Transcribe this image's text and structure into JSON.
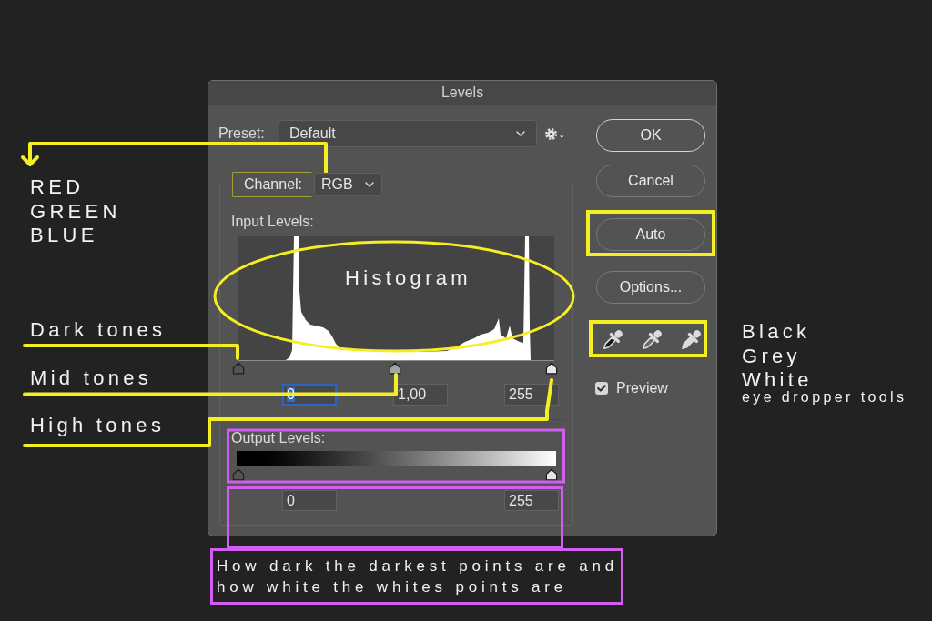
{
  "dialog": {
    "title": "Levels",
    "preset": {
      "label": "Preset:",
      "value": "Default"
    },
    "channel": {
      "label": "Channel:",
      "value": "RGB"
    },
    "input_levels": {
      "label": "Input Levels:",
      "thumbs": [
        {
          "kind": "black",
          "level": 0
        },
        {
          "kind": "grey",
          "level": 0.5
        },
        {
          "kind": "white",
          "level": 1
        }
      ],
      "fields": [
        {
          "value": "0",
          "focused": true
        },
        {
          "value": "1,00",
          "focused": false
        },
        {
          "value": "255",
          "focused": false
        }
      ]
    },
    "output_levels": {
      "label": "Output Levels:",
      "thumbs": [
        {
          "kind": "black",
          "level": 0
        },
        {
          "kind": "white",
          "level": 1
        }
      ],
      "fields": [
        {
          "value": "0",
          "focused": false
        },
        {
          "value": "255",
          "focused": false
        }
      ]
    },
    "buttons": [
      {
        "label": "OK",
        "default": true
      },
      {
        "label": "Cancel",
        "default": false
      },
      {
        "label": "Auto",
        "default": false
      },
      {
        "label": "Options...",
        "default": false
      }
    ],
    "preview": {
      "label": "Preview",
      "checked": true
    }
  },
  "annotations": {
    "channel_options": [
      "RED",
      "GREEN",
      "BLUE"
    ],
    "histogram": "Histogram",
    "tones": [
      "Dark tones",
      "Mid tones",
      "High tones"
    ],
    "eyedroppers": {
      "tools": [
        "Black",
        "Grey",
        "White"
      ],
      "caption": "eye dropper tools"
    },
    "output_note": {
      "lines": [
        "How dark the darkest points are and",
        "how white the whites points are"
      ]
    }
  }
}
